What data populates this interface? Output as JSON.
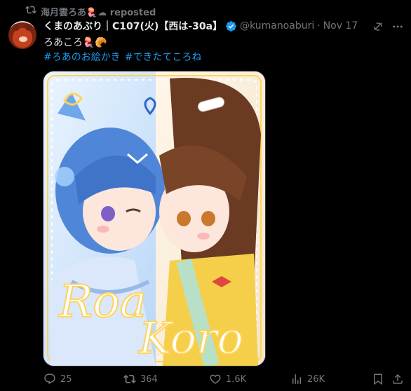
{
  "repost": {
    "label": "海月雲ろあ🪼☁ reposted"
  },
  "author": {
    "display_name": "くまのあぶり｜C107(火)【西は-30a】",
    "handle": "@kumanoaburi",
    "separator": "·",
    "date": "Nov 17"
  },
  "tweet": {
    "text": "ろあころ🪼🥐",
    "hashtags": [
      "#ろあのお絵かき",
      "#できたてころね"
    ]
  },
  "media": {
    "text_line1": "Roa",
    "text_line2": "Koro"
  },
  "actions": {
    "replies": "25",
    "reposts": "364",
    "likes": "1.6K",
    "views": "26K"
  },
  "colors": {
    "accent": "#1d9bf0",
    "muted": "#71767b",
    "text": "#e7e9ea",
    "background": "#000000"
  },
  "icons": [
    "repost-icon",
    "verified-badge-icon",
    "grok-icon",
    "more-icon",
    "reply-icon",
    "like-icon",
    "views-icon",
    "bookmark-icon",
    "share-icon"
  ]
}
